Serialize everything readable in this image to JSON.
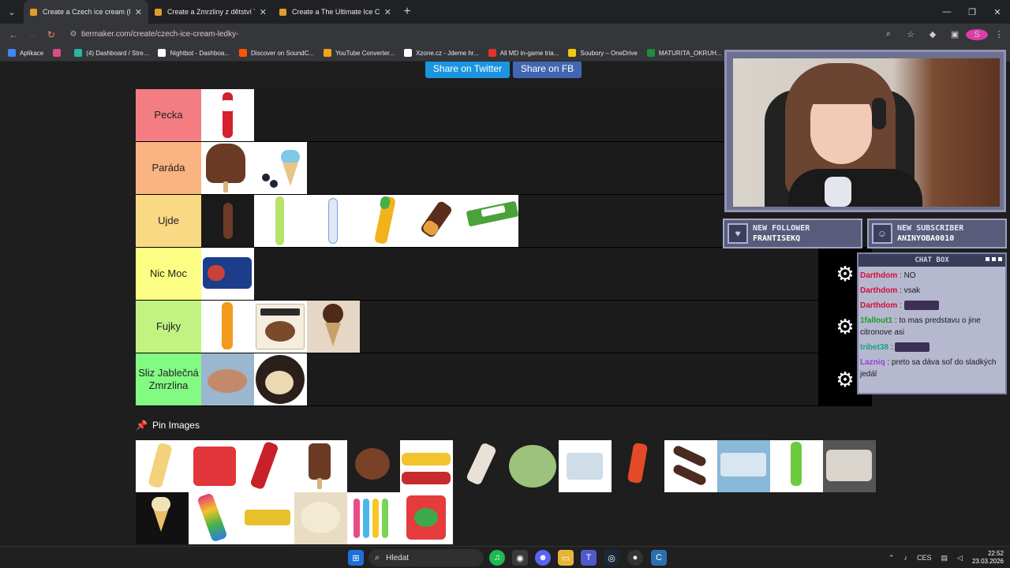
{
  "browser": {
    "tabs": [
      {
        "title": "Create a Czech ice cream (ledň",
        "active": true
      },
      {
        "title": "Create a Zmrzliny z dětství Tier",
        "active": false
      },
      {
        "title": "Create a The Ultimate Ice Cream",
        "active": false
      }
    ],
    "url": "tiermaker.com/create/czech-ice-cream-ledky-",
    "bookmarks": [
      {
        "label": "Aplikace",
        "color": "#4285f4"
      },
      {
        "label": "",
        "color": "#d94d89"
      },
      {
        "label": "(4) Dashboard / Stre...",
        "color": "#2bb3a6"
      },
      {
        "label": "Nightbot - Dashboa...",
        "color": "#ffffff"
      },
      {
        "label": "Discover on SoundC...",
        "color": "#ff5500"
      },
      {
        "label": "YouTube Converter...",
        "color": "#f4a21a"
      },
      {
        "label": "Xzone.cz - Jdeme hr...",
        "color": "#ffffff"
      },
      {
        "label": "All MD in-game tria...",
        "color": "#e2342b"
      },
      {
        "label": "Soubory – OneDrive",
        "color": "#f2c811"
      },
      {
        "label": "MATURITA_OKRUH...",
        "color": "#1e8e3e"
      }
    ]
  },
  "page": {
    "share_twitter": "Share on Twitter",
    "share_fb": "Share on FB",
    "pin_images_label": "Pin Images",
    "tiers": [
      {
        "label": "Pecka",
        "color": "#f47d84",
        "items": 1
      },
      {
        "label": "Paráda",
        "color": "#f9b482",
        "items": 2
      },
      {
        "label": "Ujde",
        "color": "#f9d983",
        "items": 6
      },
      {
        "label": "Nic Moc",
        "color": "#fbfe82",
        "items": 1
      },
      {
        "label": "Fujky",
        "color": "#c2f282",
        "items": 3
      },
      {
        "label": "Sliz Jablečná Zmrzlina",
        "color": "#83fb83",
        "items": 2
      }
    ]
  },
  "stream": {
    "new_follower_label": "NEW FOLLOWER",
    "new_follower_name": "FRANTISEKQ",
    "new_subscriber_label": "NEW SUBSCRIBER",
    "new_subscriber_name": "ANINYOBA0010",
    "chat_title": "CHAT BOX",
    "chat": [
      {
        "user": "Darthdom",
        "text": ": NO",
        "color": "red"
      },
      {
        "user": "Darthdom",
        "text": ": vsak",
        "color": "red"
      },
      {
        "user": "Darthdom",
        "text": ":",
        "color": "red",
        "emote": true
      },
      {
        "user": "1fallout1",
        "text": ": to mas predstavu o jine citronove asi",
        "color": "green"
      },
      {
        "user": "tribet38",
        "text": ":",
        "color": "teal",
        "emote": true
      },
      {
        "user": "Lazniq",
        "text": ": preto sa dáva soľ do sladkých jedál",
        "color": "purple"
      }
    ]
  },
  "taskbar": {
    "search_placeholder": "Hledat",
    "lang": "CES",
    "time": "22:52",
    "date": "23.03.2026"
  }
}
